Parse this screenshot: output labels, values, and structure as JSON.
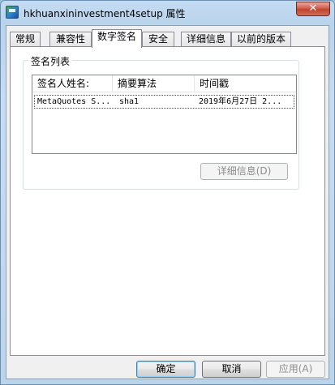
{
  "window": {
    "title": "hkhuanxininvestment4setup 属性",
    "close_label": "✕"
  },
  "tabs": [
    {
      "label": "常规"
    },
    {
      "label": "兼容性"
    },
    {
      "label": "数字签名",
      "active": true
    },
    {
      "label": "安全"
    },
    {
      "label": "详细信息"
    },
    {
      "label": "以前的版本"
    }
  ],
  "signatures": {
    "group_label": "签名列表",
    "columns": [
      "签名人姓名:",
      "摘要算法",
      "时间戳"
    ],
    "rows": [
      {
        "name": "MetaQuotes S...",
        "algorithm": "sha1",
        "timestamp": "2019年6月27日 2..."
      }
    ],
    "details_button": "详细信息(D)"
  },
  "buttons": {
    "ok": "确定",
    "cancel": "取消",
    "apply": "应用(A)"
  },
  "icons": {
    "app": "setup-app-icon",
    "close": "close-icon"
  }
}
